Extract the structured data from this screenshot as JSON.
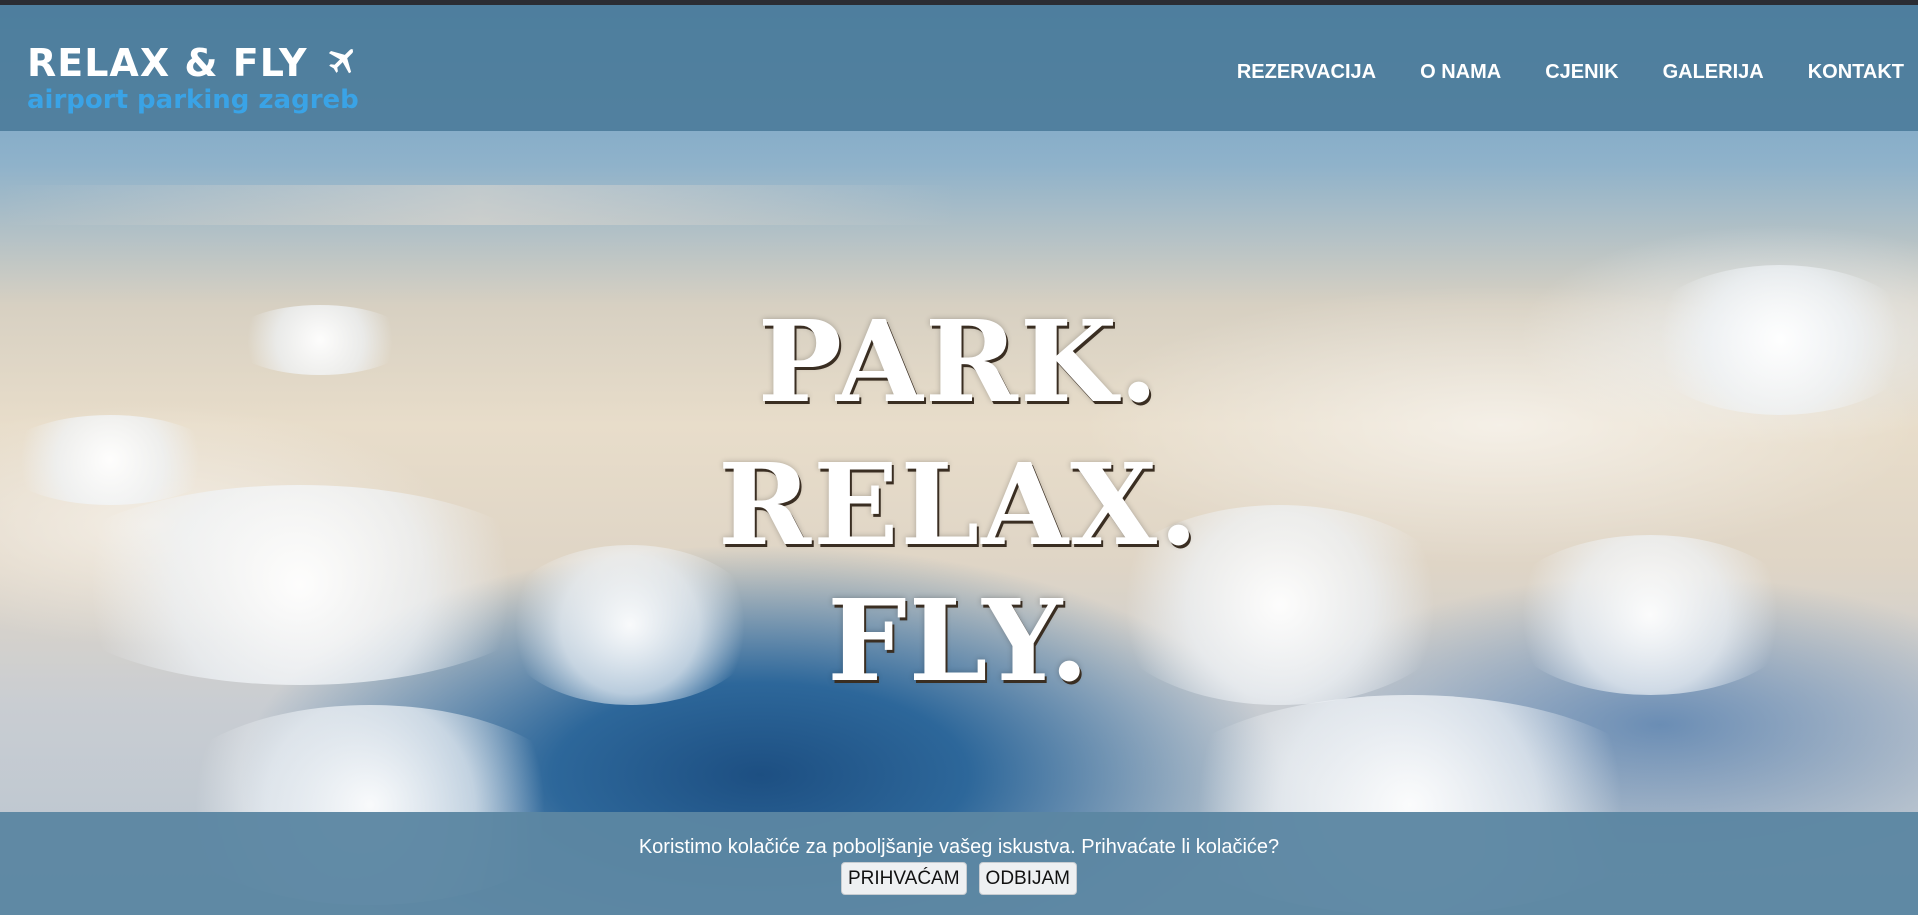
{
  "header": {
    "logo_title": "RELAX & FLY",
    "logo_subtitle": "airport parking zagreb",
    "logo_icon": "airplane-icon",
    "subtitle_color": "#3aa3e6"
  },
  "nav": {
    "items": [
      {
        "label": "REZERVACIJA"
      },
      {
        "label": "O NAMA"
      },
      {
        "label": "CJENIK"
      },
      {
        "label": "GALERIJA"
      },
      {
        "label": "KONTAKT"
      }
    ]
  },
  "hero": {
    "line1": "PARK.",
    "line2": "RELAX.",
    "line3": "FLY."
  },
  "cookie": {
    "message": "Koristimo kolačiće za poboljšanje vašeg iskustva. Prihvaćate li kolačiće?",
    "accept_label": "PRIHVAĆAM",
    "reject_label": "ODBIJAM"
  }
}
